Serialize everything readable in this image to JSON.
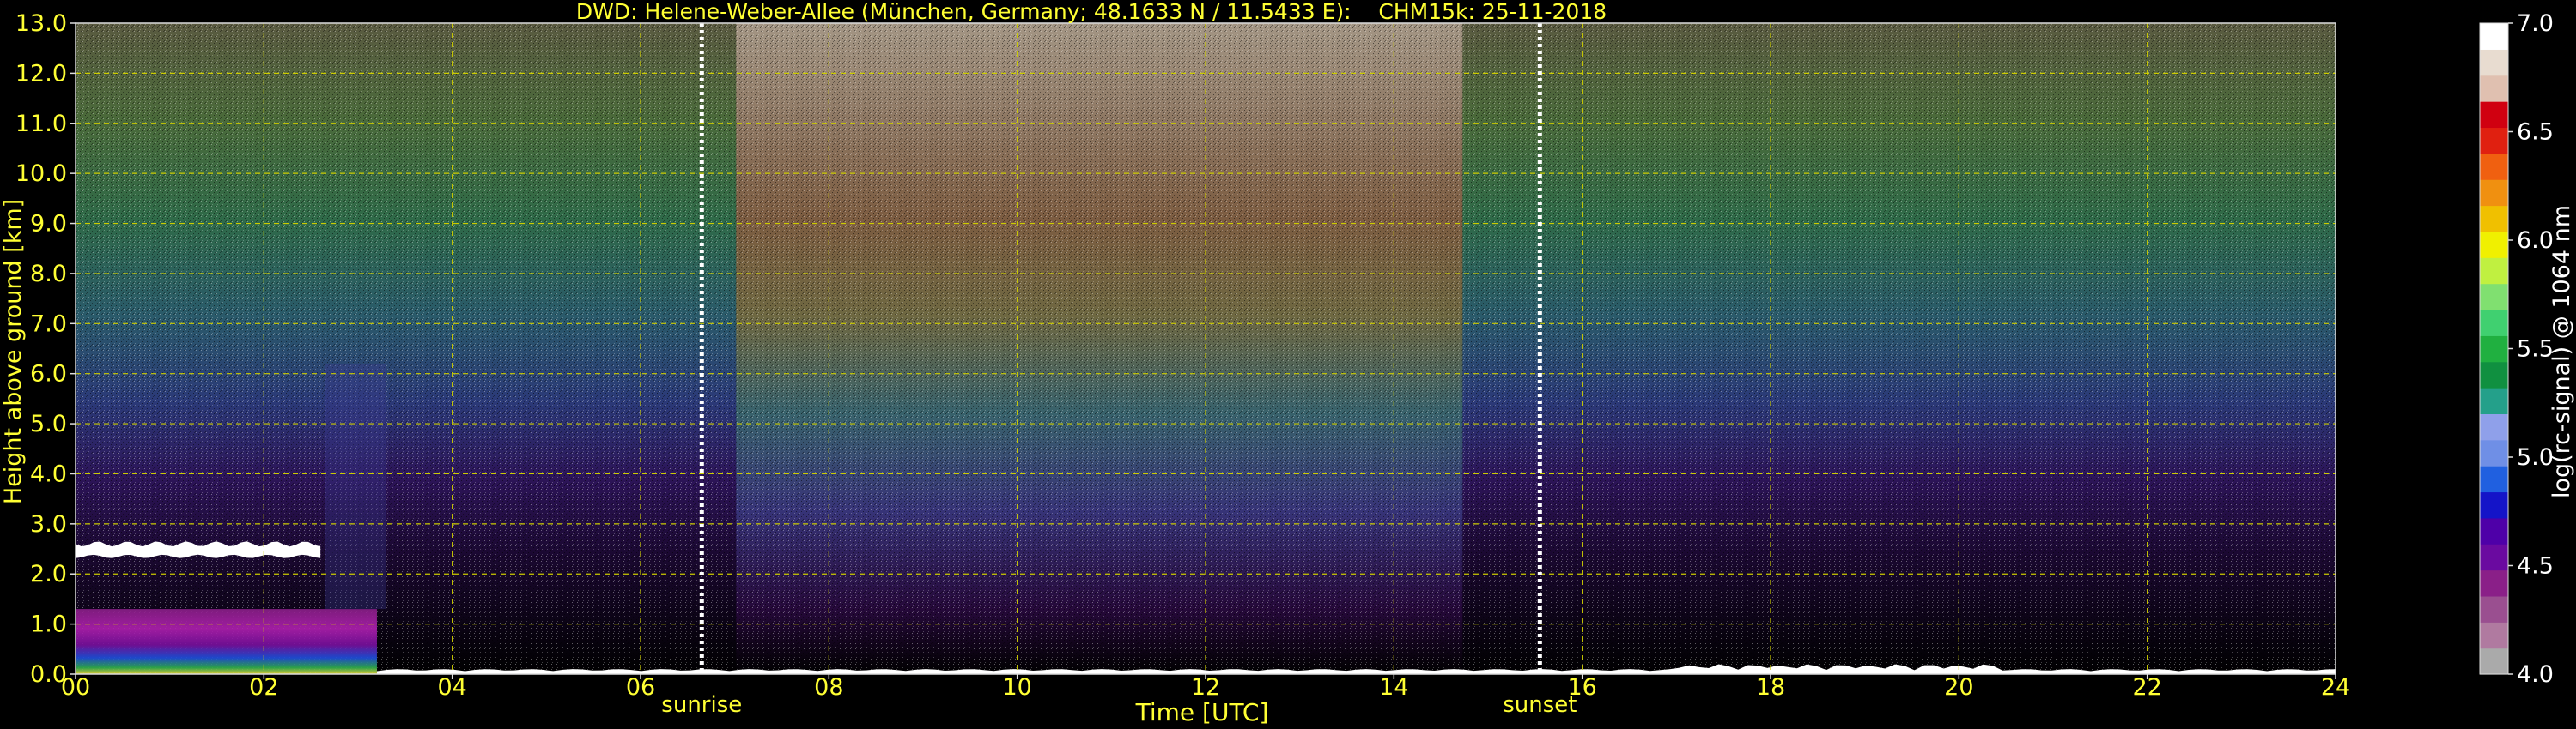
{
  "chart_data": {
    "type": "heatmap",
    "title": "DWD: Helene-Weber-Allee (München, Germany; 48.1633 N / 11.5433 E):    CHM15k: 25-11-2018",
    "xlabel": "Time [UTC]",
    "ylabel": "Height above ground [km]",
    "xlim": [
      0,
      24
    ],
    "ylim": [
      0,
      13
    ],
    "x_ticks": [
      "00",
      "02",
      "04",
      "06",
      "08",
      "10",
      "12",
      "14",
      "16",
      "18",
      "20",
      "22",
      "24"
    ],
    "y_ticks": [
      "0.0",
      "1.0",
      "2.0",
      "3.0",
      "4.0",
      "5.0",
      "6.0",
      "7.0",
      "8.0",
      "9.0",
      "10.0",
      "11.0",
      "12.0",
      "13.0"
    ],
    "grid": true,
    "markers": [
      {
        "label": "sunrise",
        "x": 6.65
      },
      {
        "label": "sunset",
        "x": 15.55
      }
    ],
    "colorbar": {
      "label": "log(rc-signal) @ 1064 nm",
      "range": [
        4.0,
        7.0
      ],
      "ticks": [
        "4.0",
        "4.5",
        "5.0",
        "5.5",
        "6.0",
        "6.5",
        "7.0"
      ],
      "colors": [
        "#aaaaaa",
        "#b07aa0",
        "#9a4f90",
        "#8a1f88",
        "#6a0aa0",
        "#4e00a8",
        "#1414c8",
        "#2060e0",
        "#6f8fe6",
        "#8fa0ea",
        "#24a08a",
        "#109040",
        "#20b040",
        "#40d070",
        "#80e070",
        "#c0f040",
        "#f0f000",
        "#f0c000",
        "#f09010",
        "#f06010",
        "#e02010",
        "#d00010",
        "#e0c0b0",
        "#e8dcd0",
        "#ffffff"
      ]
    },
    "layers": [
      {
        "name": "cloud layer",
        "x": [
          0.0,
          2.6
        ],
        "y": [
          2.35,
          2.6
        ],
        "value": 7.0
      },
      {
        "name": "boundary layer",
        "x": [
          0.0,
          3.2
        ],
        "y": [
          0.0,
          1.3
        ],
        "value": 5.6
      },
      {
        "name": "surface layer",
        "x": [
          3.2,
          24.0
        ],
        "y": [
          0.0,
          0.15
        ],
        "value": 6.8
      }
    ],
    "background_levels": [
      {
        "y": 0.5,
        "night": 4.2,
        "day": 4.3
      },
      {
        "y": 3.0,
        "night": 4.4,
        "day": 5.2
      },
      {
        "y": 5.0,
        "night": 5.0,
        "day": 5.8
      },
      {
        "y": 7.0,
        "night": 5.4,
        "day": 6.1
      },
      {
        "y": 9.0,
        "night": 5.6,
        "day": 6.3
      },
      {
        "y": 12.0,
        "night": 5.8,
        "day": 6.6
      }
    ]
  }
}
